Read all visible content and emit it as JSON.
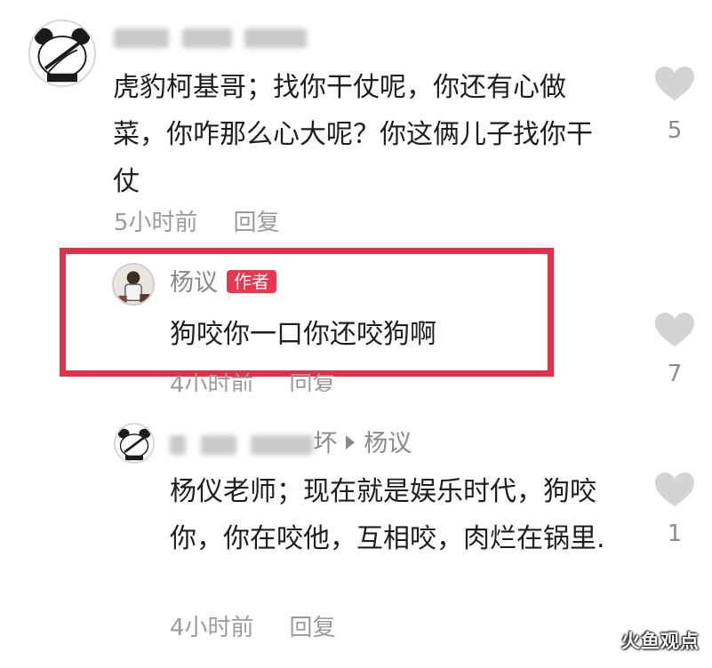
{
  "comments": [
    {
      "username_visible": "",
      "text": "虎豹柯基哥；找你干仗呢，你还有心做菜，你咋那么心大呢？你这俩儿子找你干仗",
      "time": "5小时前",
      "reply_label": "回复",
      "likes": "5"
    },
    {
      "username": "杨议",
      "badge": "作者",
      "text": "狗咬你一口你还咬狗啊",
      "time": "4小时前",
      "reply_label": "回复",
      "likes": "7"
    },
    {
      "username_visible": "坏",
      "reply_to": "杨议",
      "text": "杨仪老师；现在就是娱乐时代，狗咬你，你在咬他，互相咬，肉烂在锅里.",
      "time": "4小时前",
      "reply_label": "回复",
      "likes": "1"
    }
  ],
  "watermark": "火鱼观点",
  "colors": {
    "highlight": "#e0304a",
    "badge": "#e8384f",
    "like_icon": "#d4d4d4"
  }
}
